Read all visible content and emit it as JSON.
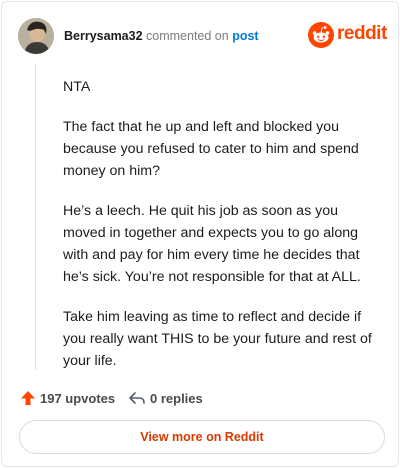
{
  "comment": {
    "author": "Berrysama32",
    "action_text": "commented on",
    "target_text": "post",
    "paragraphs": [
      "NTA",
      "The fact that he up and left and blocked you because you refused to cater to him and spend money on him?",
      "He’s a leech. He quit his job as soon as you moved in together and expects you to go along with and pay for him every time he decides that he’s sick. You’re not responsible for that at ALL.",
      "Take him leaving as time to reflect and decide if you really want THIS to be your future and rest of your life."
    ],
    "upvotes_label": "197 upvotes",
    "replies_label": "0 replies"
  },
  "brand": {
    "wordmark": "reddit",
    "accent_color": "#ff4500",
    "logo_icon": "reddit-snoo-icon"
  },
  "cta": {
    "label": "View more on Reddit",
    "color": "#d93a00"
  },
  "icons": {
    "upvote": "upvote-arrow-icon",
    "reply": "reply-arrow-icon"
  }
}
